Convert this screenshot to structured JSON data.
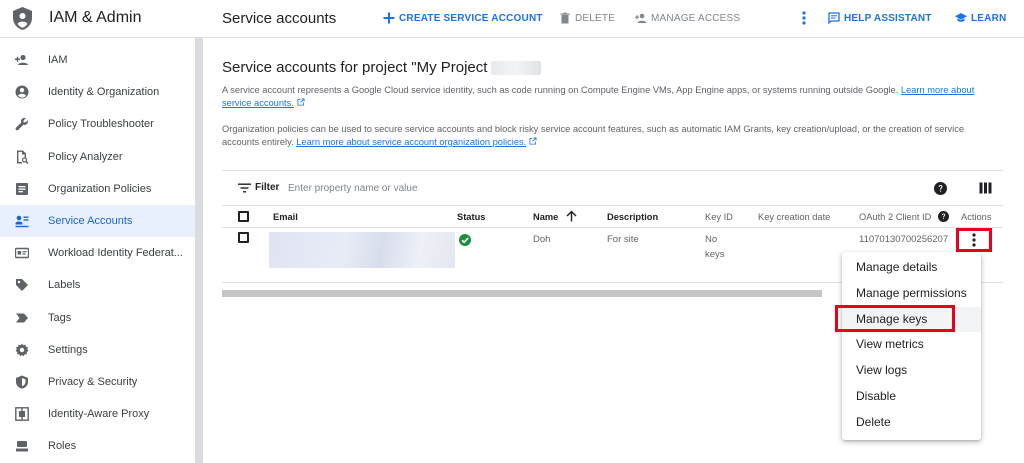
{
  "app": {
    "title": "IAM & Admin"
  },
  "sidebar": {
    "items": [
      {
        "label": "IAM",
        "icon": "person-add-icon"
      },
      {
        "label": "Identity & Organization",
        "icon": "account-circle-icon"
      },
      {
        "label": "Policy Troubleshooter",
        "icon": "wrench-icon"
      },
      {
        "label": "Policy Analyzer",
        "icon": "document-search-icon"
      },
      {
        "label": "Organization Policies",
        "icon": "list-document-icon"
      },
      {
        "label": "Service Accounts",
        "icon": "service-account-icon",
        "active": true
      },
      {
        "label": "Workload Identity Federat...",
        "icon": "id-card-icon"
      },
      {
        "label": "Labels",
        "icon": "label-tag-icon"
      },
      {
        "label": "Tags",
        "icon": "tag-arrow-icon"
      },
      {
        "label": "Settings",
        "icon": "gear-icon"
      },
      {
        "label": "Privacy & Security",
        "icon": "shield-icon"
      },
      {
        "label": "Identity-Aware Proxy",
        "icon": "proxy-icon"
      },
      {
        "label": "Roles",
        "icon": "roles-icon"
      }
    ]
  },
  "header": {
    "page_title": "Service accounts",
    "create_label": "CREATE SERVICE ACCOUNT",
    "delete_label": "DELETE",
    "manage_access_label": "MANAGE ACCESS",
    "help_assistant_label": "HELP ASSISTANT",
    "learn_label": "LEARN"
  },
  "main": {
    "section_title": "Service accounts for project \"My Project",
    "desc1_text": "A service account represents a Google Cloud service identity, such as code running on Compute Engine VMs, App Engine apps, or systems running outside Google.",
    "desc1_link": "Learn more about service accounts.",
    "desc2_text": "Organization policies can be used to secure service accounts and block risky service account features, such as automatic IAM Grants, key creation/upload, or the creation of service accounts entirely.",
    "desc2_link": "Learn more about service account organization policies."
  },
  "table": {
    "filter_label": "Filter",
    "filter_placeholder": "Enter property name or value",
    "columns": {
      "email": "Email",
      "status": "Status",
      "name": "Name",
      "description": "Description",
      "key_id": "Key ID",
      "key_creation_date": "Key creation date",
      "oauth_client_id": "OAuth 2 Client ID",
      "actions": "Actions"
    },
    "rows": [
      {
        "status": "enabled",
        "name": "Doh",
        "description": "For site",
        "key_id_line1": "No",
        "key_id_line2": "keys",
        "oauth_client_id": "11070130700256207"
      }
    ]
  },
  "context_menu": {
    "items": [
      "Manage details",
      "Manage permissions",
      "Manage keys",
      "View metrics",
      "View logs",
      "Disable",
      "Delete"
    ],
    "highlighted": "Manage keys"
  },
  "colors": {
    "accent": "#1a73e8",
    "active_bg": "#e8f0fe",
    "highlight_red": "#e8001c",
    "status_green": "#1e8e3e"
  }
}
